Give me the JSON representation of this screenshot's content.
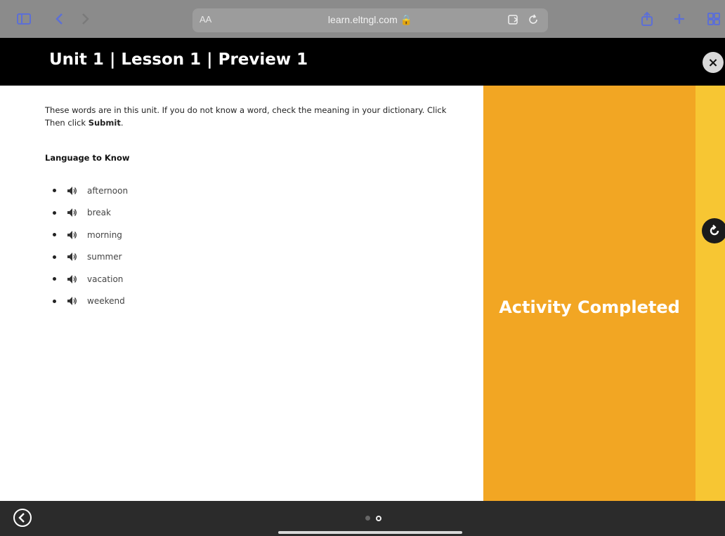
{
  "browser": {
    "text_size_label": "AA",
    "url": "learn.eltngl.com 🔒",
    "icons": [
      "sidebar-icon",
      "back-icon",
      "forward-icon",
      "reader-icon",
      "reload-icon",
      "share-icon",
      "new-tab-icon",
      "tabs-icon"
    ]
  },
  "header": {
    "title": "Unit 1 | Lesson 1 | Preview 1",
    "close_label": "×"
  },
  "content": {
    "instructions_line1": "These words are in this unit. If you do not know a word, check the meaning in your dictionary. Click",
    "instructions_line2_prefix": "Then click ",
    "instructions_line2_bold": "Submit",
    "instructions_line2_suffix": ".",
    "section_heading": "Language to Know",
    "words": [
      "afternoon",
      "break",
      "morning",
      "summer",
      "vacation",
      "weekend"
    ]
  },
  "activity": {
    "status_label": "Activity Completed",
    "panel_color": "#f2a623",
    "strip_color": "#f7c633"
  },
  "footer": {
    "page_count": 2,
    "current_page": 2
  }
}
